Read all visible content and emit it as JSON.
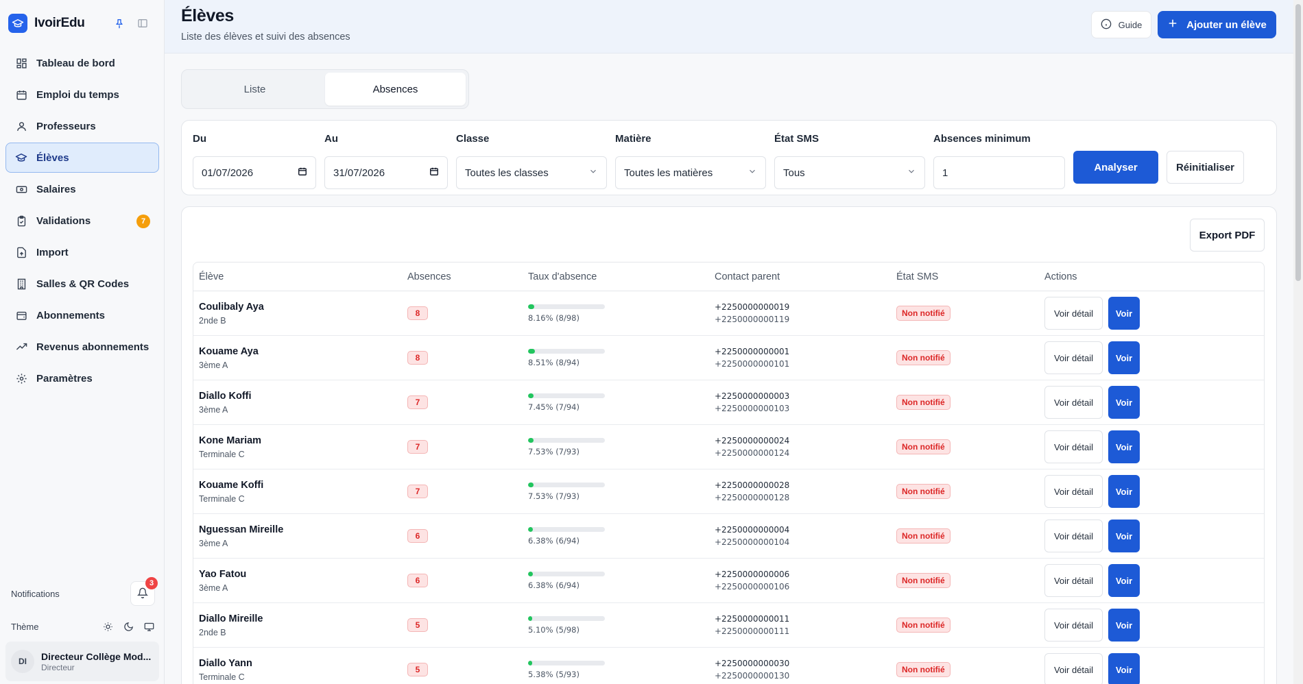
{
  "app": {
    "name": "IvoirEdu"
  },
  "sidebar": {
    "items": [
      {
        "label": "Tableau de bord",
        "icon": "dashboard-icon"
      },
      {
        "label": "Emploi du temps",
        "icon": "calendar-icon"
      },
      {
        "label": "Professeurs",
        "icon": "user-icon"
      },
      {
        "label": "Élèves",
        "icon": "graduation-cap-icon",
        "active": true
      },
      {
        "label": "Salaires",
        "icon": "banknote-icon"
      },
      {
        "label": "Validations",
        "icon": "clipboard-check-icon",
        "badge": "7"
      },
      {
        "label": "Import",
        "icon": "file-upload-icon"
      },
      {
        "label": "Salles & QR Codes",
        "icon": "building-icon"
      },
      {
        "label": "Abonnements",
        "icon": "wallet-icon"
      },
      {
        "label": "Revenus abonnements",
        "icon": "trending-up-icon"
      },
      {
        "label": "Paramètres",
        "icon": "gear-icon"
      }
    ],
    "notifications_label": "Notifications",
    "notifications_count": "3",
    "theme_label": "Thème",
    "user": {
      "initials": "DI",
      "name": "Directeur Collège Mod...",
      "role": "Directeur"
    }
  },
  "header": {
    "title": "Élèves",
    "subtitle": "Liste des élèves et suivi des absences",
    "guide_label": "Guide",
    "add_label": "Ajouter un élève"
  },
  "tabs": [
    {
      "label": "Liste",
      "active": false
    },
    {
      "label": "Absences",
      "active": true
    }
  ],
  "filters": {
    "from_label": "Du",
    "from_value": "01/07/2026",
    "to_label": "Au",
    "to_value": "31/07/2026",
    "class_label": "Classe",
    "class_value": "Toutes les classes",
    "subject_label": "Matière",
    "subject_value": "Toutes les matières",
    "sms_label": "État SMS",
    "sms_value": "Tous",
    "min_label": "Absences minimum",
    "min_value": "1",
    "analyze_label": "Analyser",
    "reset_label": "Réinitialiser"
  },
  "results": {
    "export_label": "Export PDF",
    "columns": [
      "Élève",
      "Absences",
      "Taux d'absence",
      "Contact parent",
      "État SMS",
      "Actions"
    ],
    "detail_label": "Voir détail",
    "view_label": "Voir",
    "rows": [
      {
        "name": "Coulibaly Aya",
        "class": "2nde B",
        "absences": "8",
        "rate": 8.16,
        "rate_text": "8.16% (8/98)",
        "phone1": "+2250000000019",
        "phone2": "+2250000000119",
        "sms": "Non notifié"
      },
      {
        "name": "Kouame Aya",
        "class": "3ème A",
        "absences": "8",
        "rate": 8.51,
        "rate_text": "8.51% (8/94)",
        "phone1": "+2250000000001",
        "phone2": "+2250000000101",
        "sms": "Non notifié"
      },
      {
        "name": "Diallo Koffi",
        "class": "3ème A",
        "absences": "7",
        "rate": 7.45,
        "rate_text": "7.45% (7/94)",
        "phone1": "+2250000000003",
        "phone2": "+2250000000103",
        "sms": "Non notifié"
      },
      {
        "name": "Kone Mariam",
        "class": "Terminale C",
        "absences": "7",
        "rate": 7.53,
        "rate_text": "7.53% (7/93)",
        "phone1": "+2250000000024",
        "phone2": "+2250000000124",
        "sms": "Non notifié"
      },
      {
        "name": "Kouame Koffi",
        "class": "Terminale C",
        "absences": "7",
        "rate": 7.53,
        "rate_text": "7.53% (7/93)",
        "phone1": "+2250000000028",
        "phone2": "+2250000000128",
        "sms": "Non notifié"
      },
      {
        "name": "Nguessan Mireille",
        "class": "3ème A",
        "absences": "6",
        "rate": 6.38,
        "rate_text": "6.38% (6/94)",
        "phone1": "+2250000000004",
        "phone2": "+2250000000104",
        "sms": "Non notifié"
      },
      {
        "name": "Yao Fatou",
        "class": "3ème A",
        "absences": "6",
        "rate": 6.38,
        "rate_text": "6.38% (6/94)",
        "phone1": "+2250000000006",
        "phone2": "+2250000000106",
        "sms": "Non notifié"
      },
      {
        "name": "Diallo Mireille",
        "class": "2nde B",
        "absences": "5",
        "rate": 5.1,
        "rate_text": "5.10% (5/98)",
        "phone1": "+2250000000011",
        "phone2": "+2250000000111",
        "sms": "Non notifié"
      },
      {
        "name": "Diallo Yann",
        "class": "Terminale C",
        "absences": "5",
        "rate": 5.38,
        "rate_text": "5.38% (5/93)",
        "phone1": "+2250000000030",
        "phone2": "+2250000000130",
        "sms": "Non notifié"
      }
    ]
  },
  "colors": {
    "primary": "#1d5ad6",
    "danger": "#dc2626",
    "warning": "#f59e0b",
    "success": "#22c55e"
  }
}
